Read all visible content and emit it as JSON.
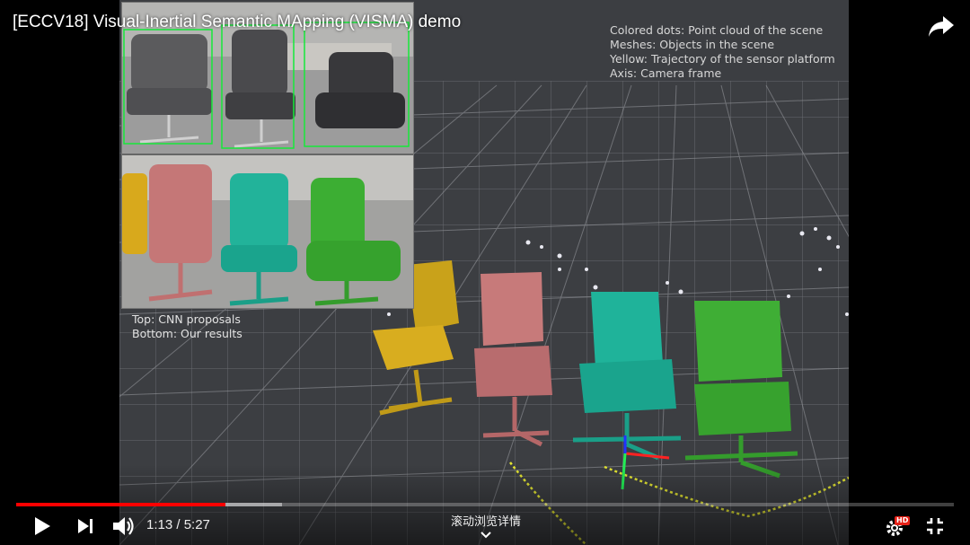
{
  "video": {
    "title": "[ECCV18] Visual-Inertial Semantic MApping (VISMA) demo",
    "legend": [
      "Colored dots: Point cloud of the scene",
      "Meshes: Objects in the scene",
      "Yellow: Trajectory of the sensor platform",
      "Axis: Camera frame"
    ],
    "inset_caption": [
      "Top: CNN proposals",
      "Bottom: Our results"
    ]
  },
  "player": {
    "current_time": "1:13",
    "duration": "5:27",
    "time_text": "1:13 / 5:27",
    "progress_fraction": 0.223,
    "buffered_fraction": 0.284,
    "scroll_hint": "滚动浏览详情",
    "hd_badge": "HD",
    "accent_color": "#ff0000"
  },
  "icons": {
    "share": "share-arrow-icon",
    "play": "play-icon",
    "next": "next-icon",
    "volume": "volume-icon",
    "settings": "gear-icon",
    "exit_fullscreen": "exit-fullscreen-icon",
    "chevron": "chevron-down-icon"
  }
}
